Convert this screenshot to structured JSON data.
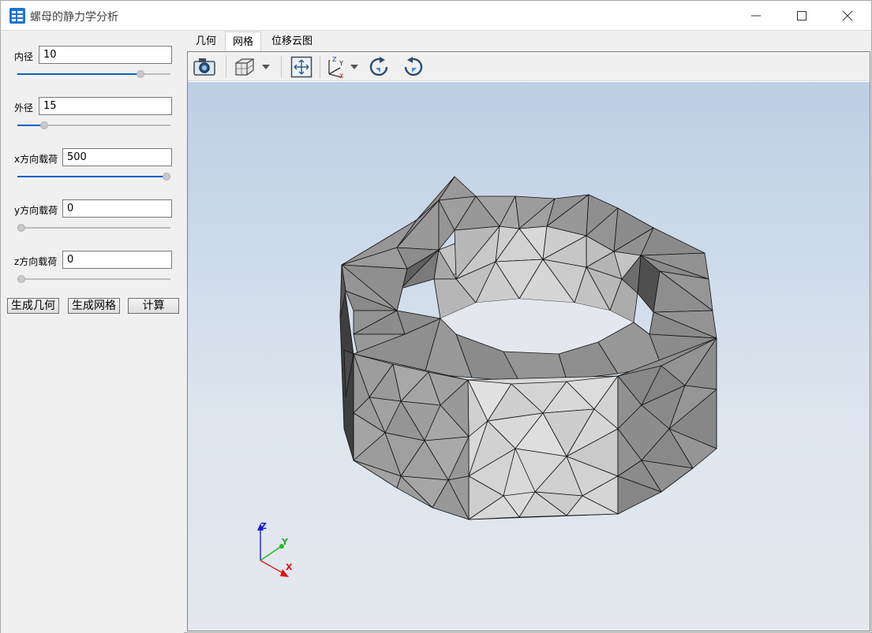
{
  "window": {
    "title": "螺母的静力学分析"
  },
  "params": {
    "inner": {
      "label": "内径",
      "value": "10",
      "slider_fraction": 0.82
    },
    "outer": {
      "label": "外径",
      "value": "15",
      "slider_fraction": 0.16
    },
    "x_load": {
      "label": "x方向载荷",
      "value": "500",
      "slider_fraction": 1.0
    },
    "y_load": {
      "label": "y方向载荷",
      "value": "0",
      "slider_fraction": 0.0
    },
    "z_load": {
      "label": "z方向载荷",
      "value": "0",
      "slider_fraction": 0.0
    }
  },
  "buttons": {
    "gen_geometry": "生成几何",
    "gen_mesh": "生成网格",
    "compute": "计算"
  },
  "tabs": [
    {
      "label": "几何",
      "active": false
    },
    {
      "label": "网格",
      "active": true
    },
    {
      "label": "位移云图",
      "active": false
    }
  ],
  "toolbar": {
    "icons": [
      "camera-icon",
      "view-cube-icon",
      "dropdown-arrow-icon",
      "fit-view-icon",
      "axes-orientation-icon",
      "dropdown-arrow-icon",
      "rotate-cw-icon",
      "rotate-ccw-icon"
    ]
  },
  "axis_triad": {
    "z": "Z",
    "y": "Y",
    "x": "X"
  },
  "colors": {
    "accent": "#0a62c4",
    "axis_x": "#ff0000",
    "axis_y": "#00cc00",
    "axis_z": "#0000ff",
    "mesh_light": "#d9d9d9",
    "mesh_mid": "#9a9a9a",
    "mesh_dark": "#6e6e6e"
  }
}
